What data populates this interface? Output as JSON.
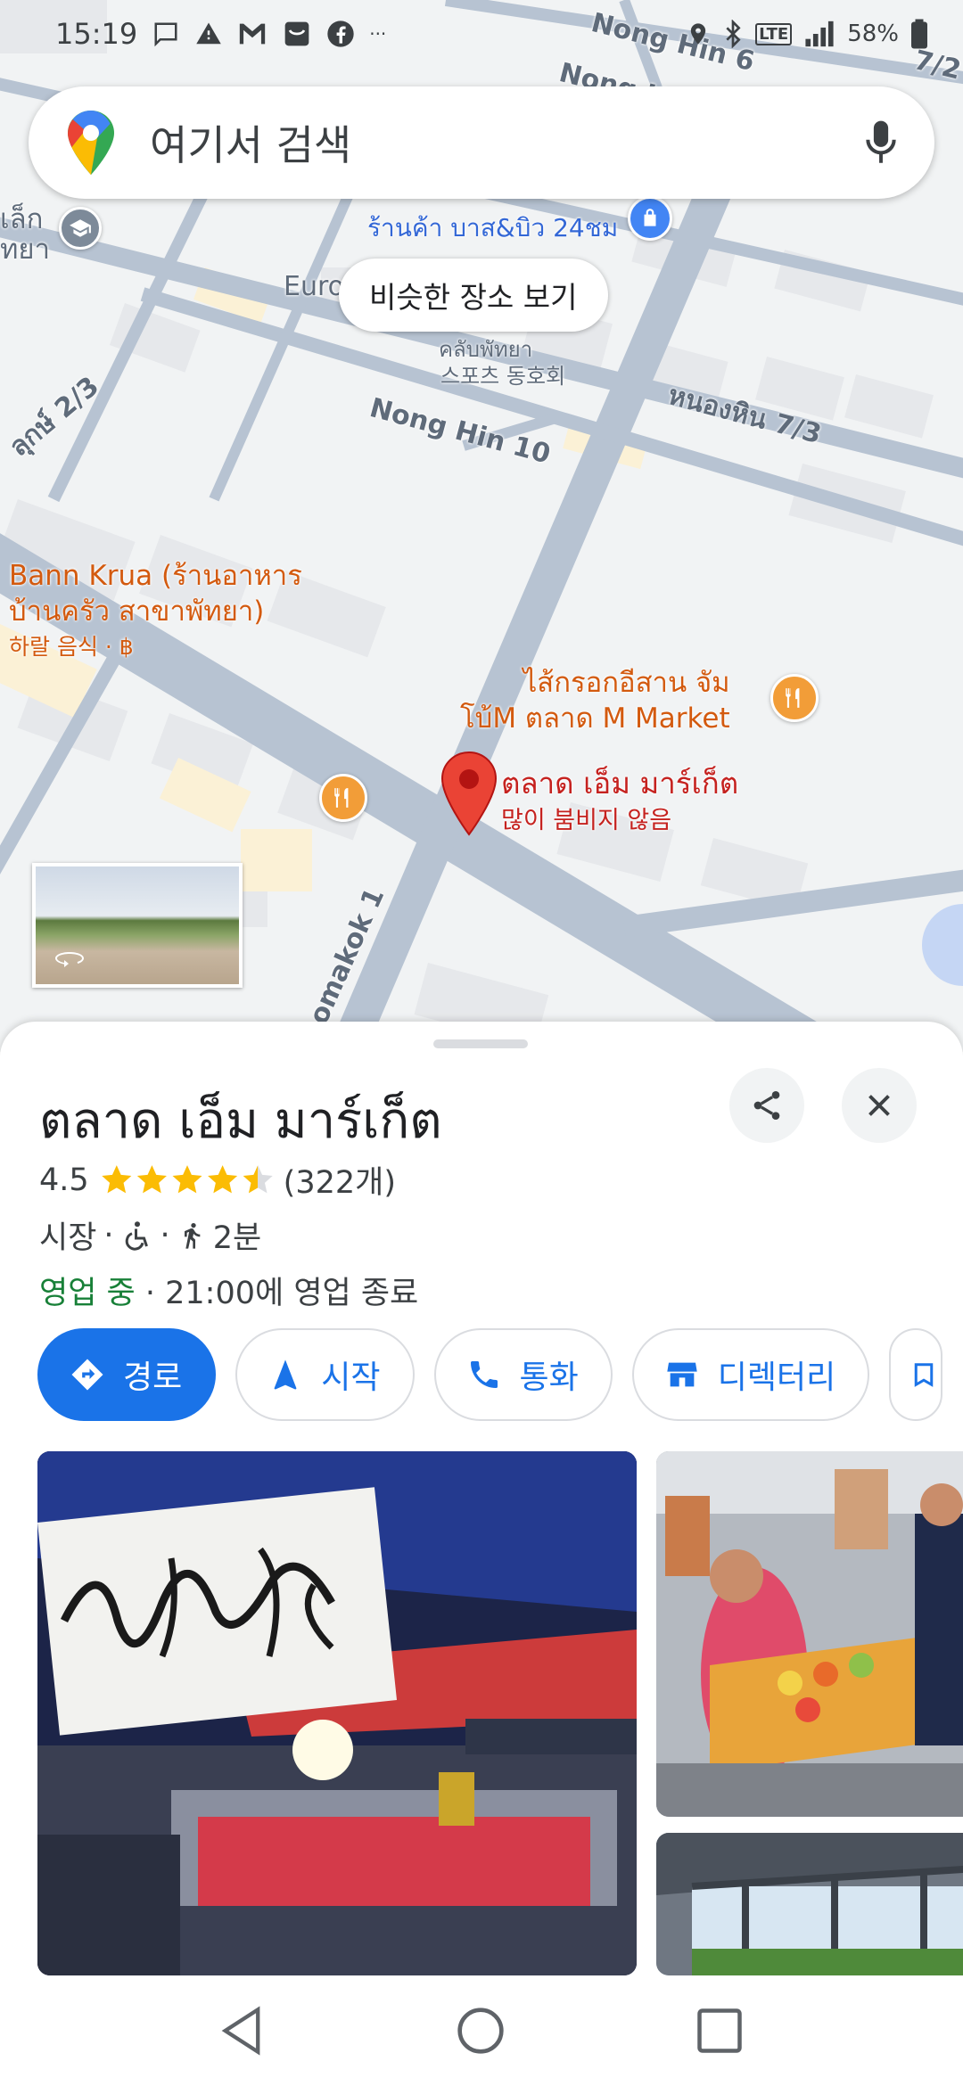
{
  "status_bar": {
    "time": "15:19",
    "battery": "58%",
    "network": "LTE",
    "notification_icons": [
      "message-icon",
      "warning-icon",
      "gmail-icon",
      "inbox-icon",
      "facebook-icon"
    ],
    "overflow": "···"
  },
  "search": {
    "placeholder": "여기서 검색"
  },
  "map": {
    "similar_places_chip": "비슷한 장소 보기",
    "roads": {
      "nong_hin_6": "Nong Hin 6",
      "nong_hin_top": "Nong Hi",
      "nong_hin_10": "Nong Hin 10",
      "nong_hin_7_3_thai": "หนองหิน 7/3",
      "road_2_3": "ลุกษ์ 2/3",
      "top_right_7_2": "7/2",
      "romakok_1": "omakok 1"
    },
    "places": {
      "left_cut": "เล็ก",
      "left_cut_2": "ทยา",
      "shop_24": "ร้านค้า บาส&บิว 24ชม",
      "euro": "Euro",
      "club_thai": "คลับพัทยา",
      "club_korean": "스포츠 동호회",
      "bann_krua_line1": "Bann Krua (ร้านอาหาร",
      "bann_krua_line2": "บ้านครัว สาขาพัทยา)",
      "bann_krua_sub": "하랄 음식 · ฿",
      "sausage_line1": "ไส้กรอกอีสาน จัม",
      "sausage_line2": "โบ้M ตลาด M Market",
      "selected_name": "ตลาด เอ็ม มาร์เก็ต",
      "selected_sub": "많이 붐비지 않음"
    }
  },
  "place": {
    "title": "ตลาด เอ็ม มาร์เก็ต",
    "rating": "4.5",
    "rating_value": 4.5,
    "review_count": "(322개)",
    "category": "시장",
    "separator": "·",
    "walk_time": "2분",
    "open_status": "영업 중",
    "hours_text": "· 21:00에 영업 종료"
  },
  "actions": [
    {
      "label": "경로",
      "icon": "directions-icon"
    },
    {
      "label": "시작",
      "icon": "navigation-arrow-icon"
    },
    {
      "label": "통화",
      "icon": "phone-icon"
    },
    {
      "label": "디렉터리",
      "icon": "storefront-icon"
    }
  ],
  "colors": {
    "accent": "#1a73e8",
    "open": "#188038",
    "poi_orange": "#d35a0f",
    "selected_red": "#c5221f",
    "star": "#fbbc04"
  }
}
